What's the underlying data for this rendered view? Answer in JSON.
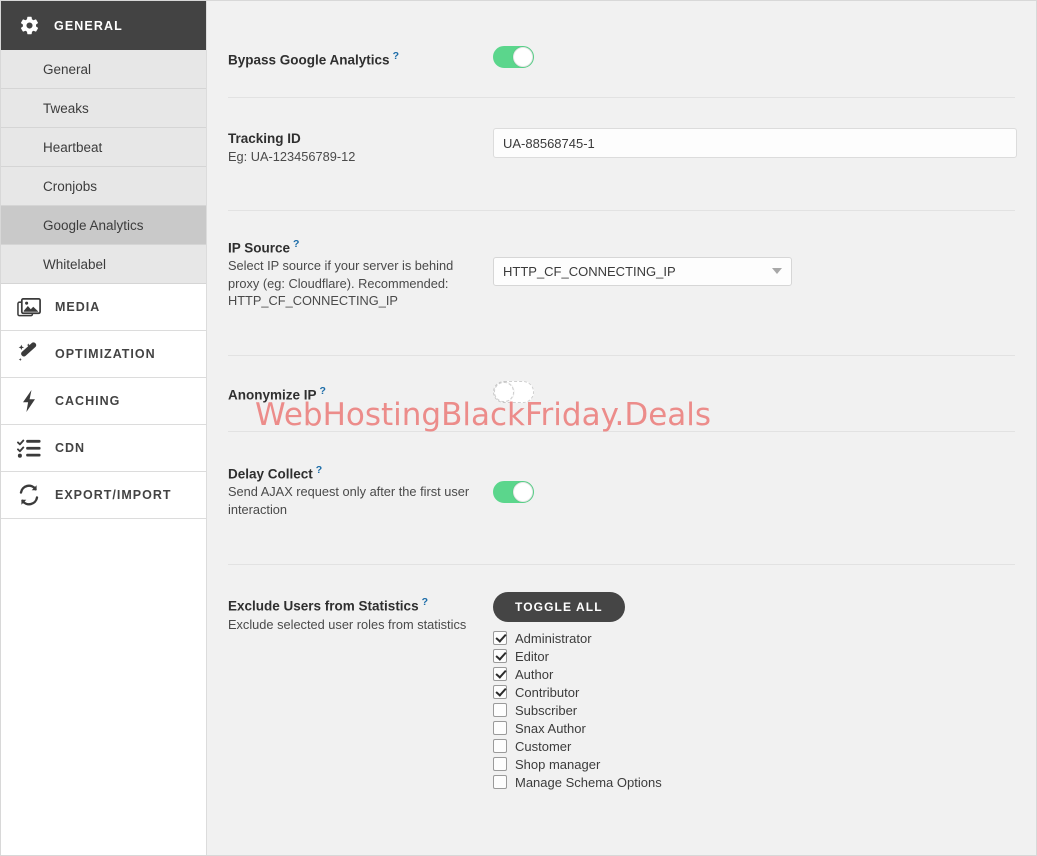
{
  "sidebar": {
    "header": {
      "label": "GENERAL",
      "icon": "gear-icon"
    },
    "sub_items": [
      {
        "label": "General",
        "active": false
      },
      {
        "label": "Tweaks",
        "active": false
      },
      {
        "label": "Heartbeat",
        "active": false
      },
      {
        "label": "Cronjobs",
        "active": false
      },
      {
        "label": "Google Analytics",
        "active": true
      },
      {
        "label": "Whitelabel",
        "active": false
      }
    ],
    "groups": [
      {
        "label": "MEDIA",
        "icon": "media-images-icon"
      },
      {
        "label": "OPTIMIZATION",
        "icon": "magic-wand-icon"
      },
      {
        "label": "CACHING",
        "icon": "lightning-bolt-icon"
      },
      {
        "label": "CDN",
        "icon": "checklist-icon"
      },
      {
        "label": "EXPORT/IMPORT",
        "icon": "refresh-sync-icon"
      }
    ]
  },
  "settings": {
    "bypass_ga": {
      "title": "Bypass Google Analytics",
      "help": "?",
      "toggle_state": "on"
    },
    "tracking_id": {
      "title": "Tracking ID",
      "desc": "Eg: UA-123456789-12",
      "value": "UA-88568745-1",
      "placeholder": ""
    },
    "ip_source": {
      "title": "IP Source",
      "help": "?",
      "desc": "Select IP source if your server is behind proxy (eg: Cloudflare). Recommended: HTTP_CF_CONNECTING_IP",
      "selected": "HTTP_CF_CONNECTING_IP"
    },
    "anonymize_ip": {
      "title": "Anonymize IP",
      "help": "?",
      "toggle_state": "off"
    },
    "delay_collect": {
      "title": "Delay Collect",
      "help": "?",
      "desc": "Send AJAX request only after the first user interaction",
      "toggle_state": "on"
    },
    "exclude_users": {
      "title": "Exclude Users from Statistics",
      "help": "?",
      "desc": "Exclude selected user roles from statistics",
      "toggle_all_label": "TOGGLE ALL",
      "roles": [
        {
          "label": "Administrator",
          "checked": true
        },
        {
          "label": "Editor",
          "checked": true
        },
        {
          "label": "Author",
          "checked": true
        },
        {
          "label": "Contributor",
          "checked": true
        },
        {
          "label": "Subscriber",
          "checked": false
        },
        {
          "label": "Snax Author",
          "checked": false
        },
        {
          "label": "Customer",
          "checked": false
        },
        {
          "label": "Shop manager",
          "checked": false
        },
        {
          "label": "Manage Schema Options",
          "checked": false
        }
      ]
    }
  },
  "watermark": {
    "text": "WebHostingBlackFriday.Deals",
    "color": "#ec8c8a"
  },
  "colors": {
    "accent_green": "#5bd68c",
    "dark": "#434343",
    "help_blue": "#1b6ca8",
    "content_bg": "#f1f1f1"
  }
}
